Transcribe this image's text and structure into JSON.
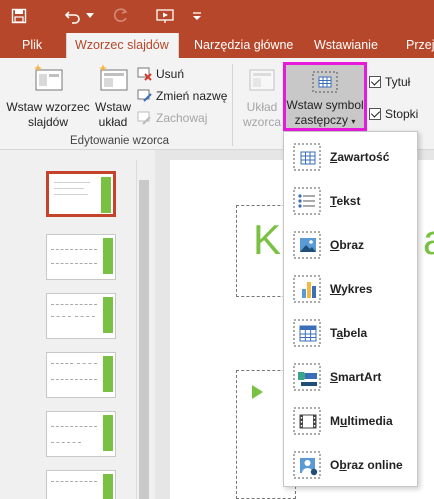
{
  "title_bar": {
    "icons": [
      "save-icon",
      "undo-icon",
      "undo-dropdown-icon",
      "redo-icon",
      "start-slideshow-icon",
      "customize-qat-icon"
    ]
  },
  "tabs": [
    {
      "label": "Plik",
      "active": false
    },
    {
      "label": "Wzorzec slajdów",
      "active": true
    },
    {
      "label": "Narzędzia główne",
      "active": false
    },
    {
      "label": "Wstawianie",
      "active": false
    },
    {
      "label": "Przejś",
      "active": false
    }
  ],
  "ribbon": {
    "insert_master": {
      "line1": "Wstaw wzorzec",
      "line2": "slajdów"
    },
    "insert_layout": {
      "line1": "Wstaw",
      "line2": "układ"
    },
    "delete": "Usuń",
    "rename": "Zmień nazwę",
    "preserve": "Zachowaj",
    "group_edit_label": "Edytowanie wzorca",
    "master_layout": {
      "line1": "Układ",
      "line2": "wzorca"
    },
    "insert_placeholder": {
      "line1": "Wstaw symbol",
      "line2": "zastępczy"
    },
    "title_checkbox": "Tytuł",
    "footers_checkbox": "Stopki"
  },
  "slide_preview": {
    "title_fragment_left": "Kl",
    "title_fragment_right": "a",
    "accent": "#7ac143"
  },
  "dropdown": {
    "items": [
      {
        "label": "Zawartość",
        "underline": "Z",
        "rest": "awartość",
        "icon": "content-placeholder-icon"
      },
      {
        "label": "Tekst",
        "underline": "T",
        "rest": "ekst",
        "icon": "text-placeholder-icon"
      },
      {
        "label": "Obraz",
        "underline": "O",
        "rest": "braz",
        "icon": "picture-placeholder-icon"
      },
      {
        "label": "Wykres",
        "underline": "W",
        "rest": "ykres",
        "icon": "chart-placeholder-icon"
      },
      {
        "label": "Tabela",
        "underline": "a",
        "pre": "T",
        "rest": "bela",
        "icon": "table-placeholder-icon"
      },
      {
        "label": "SmartArt",
        "underline": "S",
        "rest": "martArt",
        "icon": "smartart-placeholder-icon"
      },
      {
        "label": "Multimedia",
        "underline": "u",
        "pre": "M",
        "rest": "ltimedia",
        "icon": "media-placeholder-icon"
      },
      {
        "label": "Obraz online",
        "underline": "b",
        "pre": "O",
        "rest": "raz online",
        "icon": "online-picture-placeholder-icon"
      }
    ]
  },
  "colors": {
    "brand": "#b7472a",
    "highlight": "#e71adb",
    "accent": "#7ac143"
  }
}
